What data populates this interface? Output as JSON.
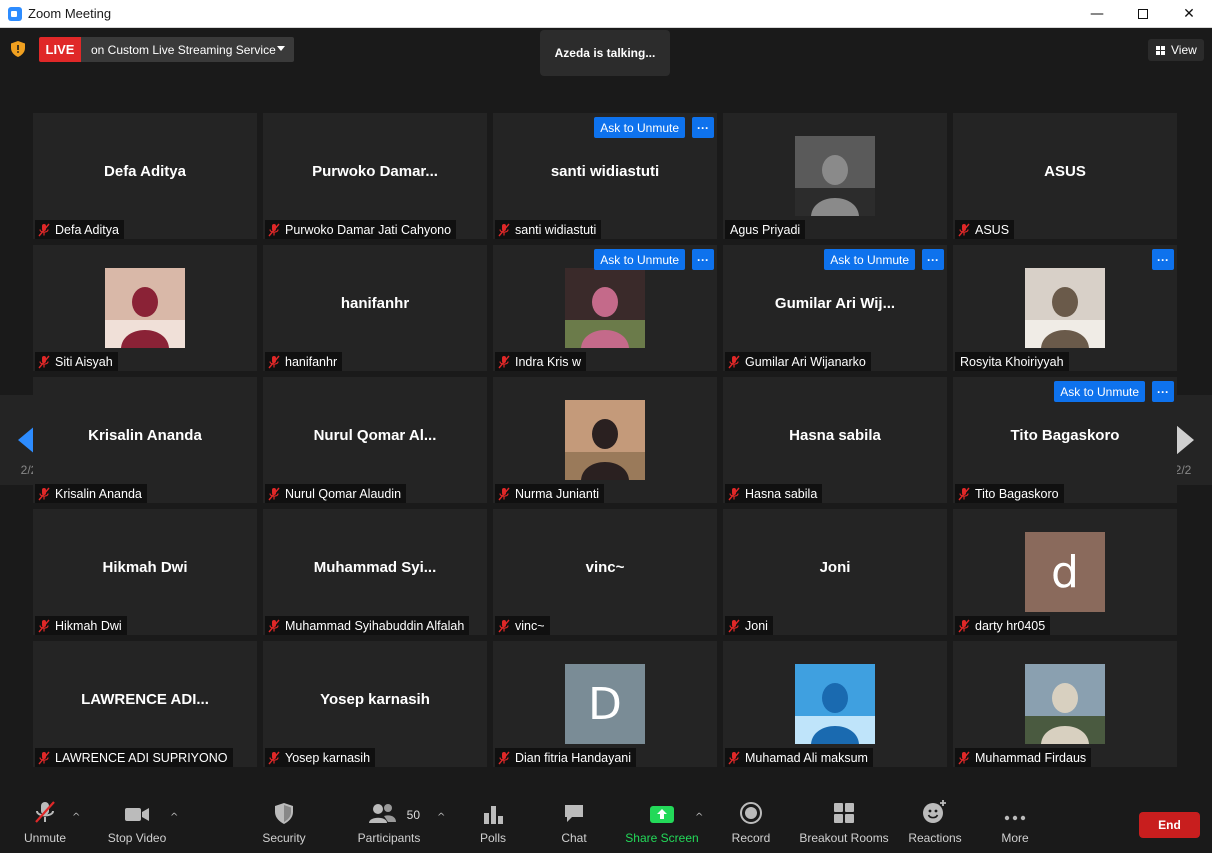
{
  "window": {
    "title": "Zoom Meeting",
    "controls": [
      "minimize",
      "maximize",
      "close"
    ]
  },
  "topbar": {
    "live_badge": "LIVE",
    "live_service": "on Custom Live Streaming Service",
    "talking_banner": "Azeda is talking...",
    "view_label": "View"
  },
  "pagination": {
    "left_page": "2/2",
    "right_page": "2/2"
  },
  "tiles": [
    {
      "big_name": "Defa Aditya",
      "label": "Defa Aditya",
      "muted": true,
      "avatar": "none"
    },
    {
      "big_name": "Purwoko  Damar...",
      "label": "Purwoko Damar Jati Cahyono",
      "muted": true,
      "avatar": "none"
    },
    {
      "big_name": "santi widiastuti",
      "label": "santi widiastuti",
      "muted": true,
      "avatar": "none",
      "ask_unmute": "Ask to Unmute",
      "more": "···"
    },
    {
      "big_name": "",
      "label": "Agus Priyadi",
      "muted": false,
      "avatar": "photo"
    },
    {
      "big_name": "ASUS",
      "label": "ASUS",
      "muted": true,
      "avatar": "none"
    },
    {
      "big_name": "",
      "label": "Siti Aisyah",
      "muted": true,
      "avatar": "photo"
    },
    {
      "big_name": "hanifanhr",
      "label": "hanifanhr",
      "muted": true,
      "avatar": "none"
    },
    {
      "big_name": "",
      "label": "Indra Kris w",
      "muted": true,
      "avatar": "photo",
      "ask_unmute": "Ask to Unmute",
      "more": "···"
    },
    {
      "big_name": "Gumilar  Ari  Wij...",
      "label": "Gumilar Ari Wijanarko",
      "muted": true,
      "avatar": "none",
      "ask_unmute": "Ask to Unmute",
      "more": "···"
    },
    {
      "big_name": "",
      "label": "Rosyita Khoiriyyah",
      "muted": false,
      "avatar": "photo",
      "more": "···"
    },
    {
      "big_name": "Krisalin Ananda",
      "label": "Krisalin Ananda",
      "muted": true,
      "avatar": "none"
    },
    {
      "big_name": "Nurul  Qomar  Al...",
      "label": "Nurul Qomar Alaudin",
      "muted": true,
      "avatar": "none"
    },
    {
      "big_name": "",
      "label": "Nurma Junianti",
      "muted": true,
      "avatar": "photo"
    },
    {
      "big_name": "Hasna sabila",
      "label": "Hasna sabila",
      "muted": true,
      "avatar": "none"
    },
    {
      "big_name": "Tito Bagaskoro",
      "label": "Tito Bagaskoro",
      "muted": true,
      "avatar": "none",
      "ask_unmute": "Ask to Unmute",
      "more": "···"
    },
    {
      "big_name": "Hikmah Dwi",
      "label": "Hikmah Dwi",
      "muted": true,
      "avatar": "none"
    },
    {
      "big_name": "Muhammad  Syi...",
      "label": "Muhammad Syihabuddin Alfalah",
      "muted": true,
      "avatar": "none"
    },
    {
      "big_name": "vinc~",
      "label": "vinc~",
      "muted": true,
      "avatar": "none"
    },
    {
      "big_name": "Joni",
      "label": "Joni",
      "muted": true,
      "avatar": "none"
    },
    {
      "big_name": "",
      "label": "darty hr0405",
      "muted": true,
      "avatar": "letter",
      "letter": "d",
      "letter_bg": "#8a6a5c"
    },
    {
      "big_name": "LAWRENCE  ADI...",
      "label": "LAWRENCE ADI SUPRIYONO",
      "muted": true,
      "avatar": "none"
    },
    {
      "big_name": "Yosep karnasih",
      "label": "Yosep karnasih",
      "muted": true,
      "avatar": "none"
    },
    {
      "big_name": "",
      "label": "Dian fitria Handayani",
      "muted": true,
      "avatar": "letter",
      "letter": "D",
      "letter_bg": "#7a8c96"
    },
    {
      "big_name": "",
      "label": "Muhamad Ali maksum",
      "muted": true,
      "avatar": "photo"
    },
    {
      "big_name": "",
      "label": "Muhammad Firdaus",
      "muted": true,
      "avatar": "photo"
    }
  ],
  "toolbar": {
    "unmute": "Unmute",
    "stop_video": "Stop Video",
    "security": "Security",
    "participants": "Participants",
    "participants_count": "50",
    "polls": "Polls",
    "chat": "Chat",
    "share_screen": "Share Screen",
    "record": "Record",
    "breakout_rooms": "Breakout Rooms",
    "reactions": "Reactions",
    "more": "More",
    "end": "End"
  },
  "colors": {
    "accent_blue": "#0e72ed",
    "live_red": "#e02828",
    "share_green": "#23d959",
    "end_red": "#c81e1e"
  }
}
